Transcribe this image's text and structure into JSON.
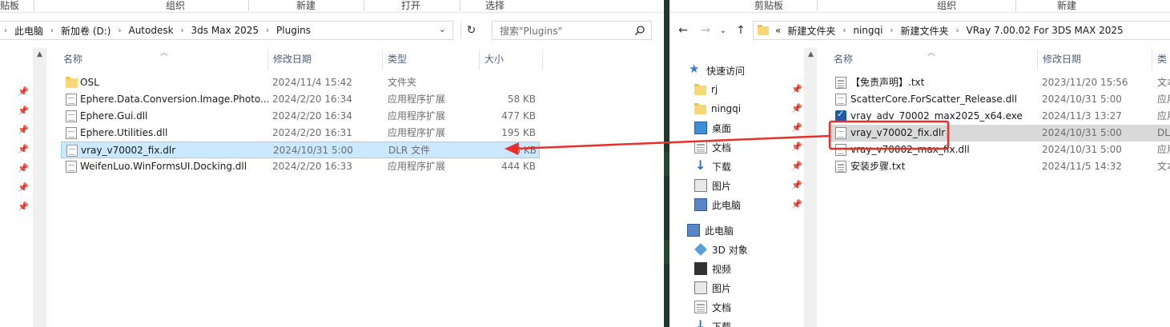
{
  "left": {
    "ribbon": {
      "clipboard": "贴板",
      "organize": "组织",
      "new": "新建",
      "open": "打开",
      "select": "选择"
    },
    "breadcrumb": [
      "此电脑",
      "新加卷 (D:)",
      "Autodesk",
      "3ds Max 2025",
      "Plugins"
    ],
    "search_placeholder": "搜索\"Plugins\"",
    "columns": {
      "name": "名称",
      "date": "修改日期",
      "type": "类型",
      "size": "大小"
    },
    "files": [
      {
        "name": "OSL",
        "date": "2024/11/4 15:42",
        "type": "文件夹",
        "size": "",
        "icon": "folder-icon"
      },
      {
        "name": "Ephere.Data.Conversion.Image.Photo...",
        "date": "2024/2/20 16:34",
        "type": "应用程序扩展",
        "size": "58 KB",
        "icon": "dll-file-icon"
      },
      {
        "name": "Ephere.Gui.dll",
        "date": "2024/2/20 16:34",
        "type": "应用程序扩展",
        "size": "477 KB",
        "icon": "dll-file-icon"
      },
      {
        "name": "Ephere.Utilities.dll",
        "date": "2024/2/20 16:31",
        "type": "应用程序扩展",
        "size": "195 KB",
        "icon": "dll-file-icon"
      },
      {
        "name": "vray_v70002_fix.dlr",
        "date": "2024/10/31 5:00",
        "type": "DLR 文件",
        "size": "3 KB",
        "icon": "blank-file-icon"
      },
      {
        "name": "WeifenLuo.WinFormsUI.Docking.dll",
        "date": "2024/2/20 16:33",
        "type": "应用程序扩展",
        "size": "444 KB",
        "icon": "dll-file-icon"
      }
    ],
    "selected_index": 4
  },
  "right": {
    "ribbon": {
      "clipboard": "剪贴板",
      "organize": "组织",
      "new": "新建"
    },
    "breadcrumb_overflow": "«",
    "breadcrumb": [
      "新建文件夹",
      "ningqi",
      "新建文件夹",
      "VRay 7.00.02 For 3DS MAX 2025"
    ],
    "columns": {
      "name": "名称",
      "date": "修改日期",
      "type": "类"
    },
    "nav": {
      "quick_access": "快速访问",
      "quick_items": [
        "rj",
        "ningqi",
        "桌面",
        "文档",
        "下载",
        "图片",
        "此电脑"
      ],
      "this_pc": "此电脑",
      "pc_items": [
        "3D 对象",
        "视频",
        "图片",
        "文档",
        "下载"
      ]
    },
    "files": [
      {
        "name": "【免责声明】.txt",
        "date": "2023/11/20 15:56",
        "type": "文本",
        "icon": "text-file-icon"
      },
      {
        "name": "ScatterCore.ForScatter_Release.dll",
        "date": "2024/10/31 5:00",
        "type": "应用",
        "icon": "dll-file-icon"
      },
      {
        "name": "vray_adv_70002_max2025_x64.exe",
        "date": "2024/11/3 13:27",
        "type": "应用",
        "icon": "installer-icon"
      },
      {
        "name": "vray_v70002_fix.dlr",
        "date": "2024/10/31 5:00",
        "type": "DLR",
        "icon": "blank-file-icon"
      },
      {
        "name": "vray_v70002_max_fix.dll",
        "date": "2024/10/31 5:00",
        "type": "应用",
        "icon": "dll-file-icon"
      },
      {
        "name": "安装步骤.txt",
        "date": "2024/11/5 14:32",
        "type": "文本",
        "icon": "text-file-icon"
      }
    ],
    "highlighted_index": 3
  },
  "annotation": {
    "box_color": "#e8302a",
    "arrow_color": "#e8302a"
  },
  "colors": {
    "selection": "#cce8ff",
    "selection_border": "#99d1ff",
    "header_text": "#4c607a",
    "folder": "#f8d775"
  }
}
